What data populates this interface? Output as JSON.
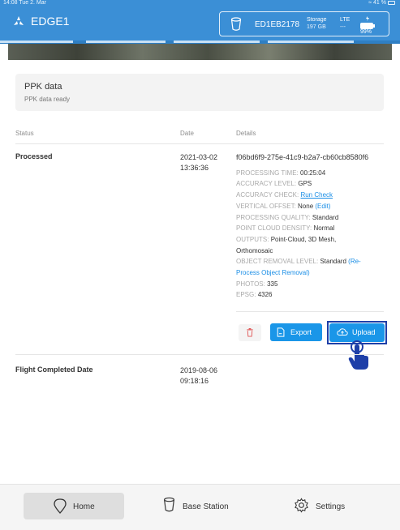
{
  "status_bar": {
    "time_date": "14:08  Tue 2. Mar",
    "battery_pct": "41 %"
  },
  "header": {
    "app_name": "EDGE1",
    "device_id": "ED1EB2178",
    "storage_label": "Storage",
    "storage_value": "197 GB",
    "lte_label": "LTE",
    "lte_value": "---",
    "battery_label": "99%"
  },
  "ppk": {
    "title": "PPK data",
    "subtitle": "PPK data ready"
  },
  "columns": {
    "status": "Status",
    "date": "Date",
    "details": "Details"
  },
  "row_processed": {
    "status": "Processed",
    "date_day": "2021-03-02",
    "date_time": "13:36:36",
    "id": "f06bd6f9-275e-41c9-b2a7-cb60cb8580f6",
    "processing_time_label": "PROCESSING TIME:",
    "processing_time": "00:25:04",
    "accuracy_level_label": "ACCURACY LEVEL:",
    "accuracy_level": "GPS",
    "accuracy_check_label": "ACCURACY CHECK:",
    "accuracy_check_link": "Run Check",
    "vertical_offset_label": "VERTICAL OFFSET:",
    "vertical_offset": "None",
    "vertical_offset_edit": "(Edit)",
    "processing_quality_label": "PROCESSING QUALITY:",
    "processing_quality": "Standard",
    "point_cloud_density_label": "POINT CLOUD DENSITY:",
    "point_cloud_density": "Normal",
    "outputs_label": "OUTPUTS:",
    "outputs_line1": "Point-Cloud, 3D Mesh,",
    "outputs_line2": "Orthomosaic",
    "object_removal_label": "OBJECT REMOVAL LEVEL:",
    "object_removal": "Standard",
    "reprocess_link_1": "(Re-",
    "reprocess_link_2": "Process Object Removal)",
    "photos_label": "PHOTOS:",
    "photos": "335",
    "epsg_label": "EPSG:",
    "epsg": "4326"
  },
  "actions": {
    "export_label": "Export",
    "upload_label": "Upload"
  },
  "row_flight": {
    "label": "Flight Completed Date",
    "date_day": "2019-08-06",
    "date_time": "09:18:16"
  },
  "bottom_nav": {
    "home": "Home",
    "base_station": "Base Station",
    "settings": "Settings"
  },
  "icons": {
    "app_logo": "drone-logo-icon",
    "device": "base-station-icon",
    "battery": "battery-icon",
    "delete": "trash-icon",
    "export": "file-export-icon",
    "upload": "cloud-upload-icon",
    "pointer": "hand-pointer-icon",
    "home": "map-pin-icon",
    "settings": "gear-icon"
  },
  "colors": {
    "header_bg": "#3b8fd6",
    "accent": "#1a96e8",
    "link": "#1a8ee6",
    "highlight_frame": "#1e3fa8",
    "delete_icon": "#e05555"
  }
}
